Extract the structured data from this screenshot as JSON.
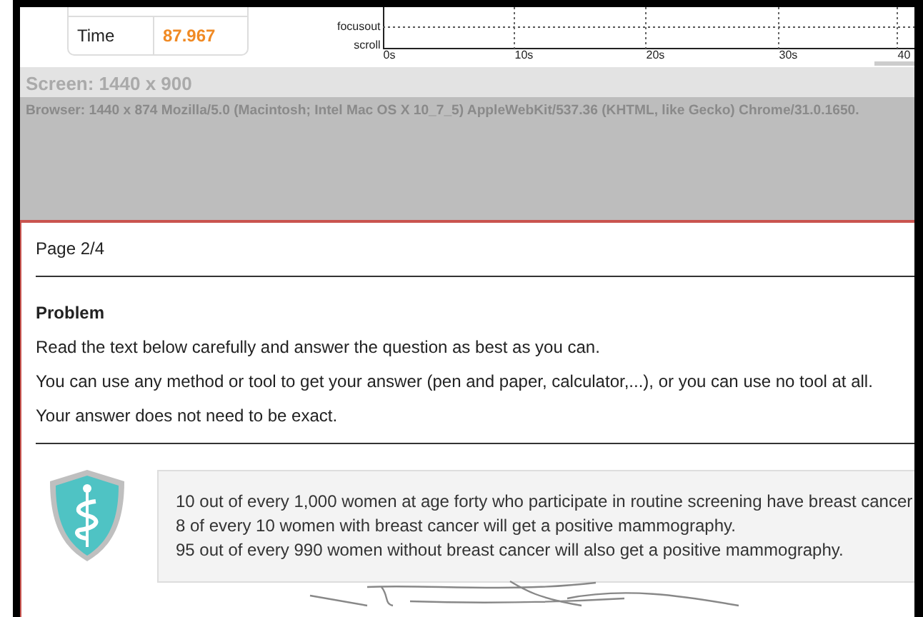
{
  "stats": {
    "rows": [
      {
        "label": "Time",
        "value": "87.967"
      }
    ]
  },
  "timeline": {
    "events": [
      "focusout",
      "scroll"
    ],
    "ticks": [
      "0s",
      "10s",
      "20s",
      "30s",
      "40"
    ]
  },
  "screen": {
    "title": "Screen: 1440 x 900",
    "browser": "Browser: 1440 x 874 Mozilla/5.0 (Macintosh; Intel Mac OS X 10_7_5) AppleWebKit/537.36 (KHTML, like Gecko) Chrome/31.0.1650."
  },
  "page": {
    "indicator": "Page 2/4",
    "heading": "Problem",
    "paragraphs": [
      "Read the text below carefully and answer the question as best as you can.",
      "You can use any method or tool to get your answer (pen and paper, calculator,...), or you can use no tool at all.",
      "Your answer does not need to be exact."
    ],
    "facts": [
      "10 out of every 1,000 women at age forty who participate in routine screening have breast cancer",
      "8 of every 10 women with breast cancer will get a positive mammography.",
      "95 out of every 990 women without breast cancer will also get a positive mammography."
    ]
  }
}
